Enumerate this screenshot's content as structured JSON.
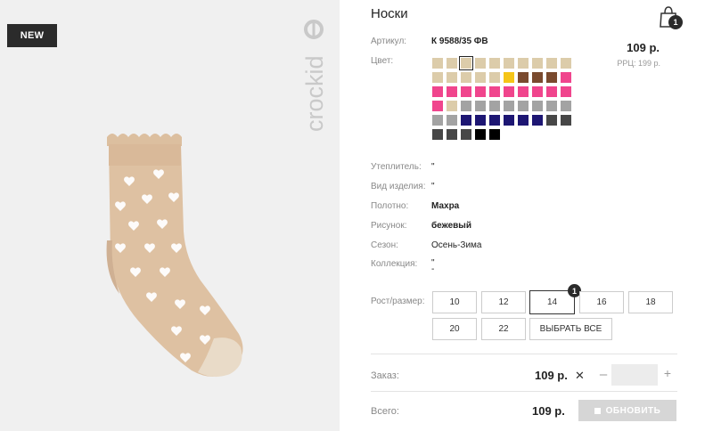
{
  "product": {
    "badge": "NEW",
    "brand": "crockid",
    "title": "Носки",
    "price": "109 р.",
    "rrp": "РРЦ: 199 р."
  },
  "cart": {
    "count": "1"
  },
  "colors": {
    "beige": "#dcccaa",
    "yellow": "#f5c518",
    "brown": "#7a4a2e",
    "pink": "#f0458d",
    "gray": "#a3a3a3",
    "navy": "#1d1673",
    "dark": "#474747",
    "black": "#000000",
    "button_disabled": "#d6d6d6"
  },
  "swatches": [
    "beige",
    "beige",
    "beige",
    "beige",
    "beige",
    "beige",
    "beige",
    "beige",
    "beige",
    "beige",
    "beige",
    "beige",
    "beige",
    "beige",
    "beige",
    "yellow",
    "brown",
    "brown",
    "brown",
    "pink",
    "pink",
    "pink",
    "pink",
    "pink",
    "pink",
    "pink",
    "pink",
    "pink",
    "pink",
    "pink",
    "pink",
    "beige",
    "gray",
    "gray",
    "gray",
    "gray",
    "gray",
    "gray",
    "gray",
    "gray",
    "gray",
    "gray",
    "navy",
    "navy",
    "navy",
    "navy",
    "navy",
    "navy",
    "dark",
    "dark",
    "dark",
    "dark",
    "dark",
    "black",
    "black"
  ],
  "selected_swatch": 2,
  "attributes": {
    "article_label": "Артикул:",
    "article_value": "К 9588/35 ФВ",
    "color_label": "Цвет:",
    "insulation_label": "Утеплитель:",
    "insulation_value": "\"",
    "type_label": "Вид изделия:",
    "type_value": "\"",
    "fabric_label": "Полотно:",
    "fabric_value": "Махра",
    "pattern_label": "Рисунок:",
    "pattern_value": "бежевый",
    "season_label": "Сезон:",
    "season_value": "Осень-Зима",
    "collection_label": "Коллекция:",
    "collection_value_1": "\"",
    "collection_value_2": "-"
  },
  "sizes": {
    "label": "Рост/размер:",
    "options": [
      "10",
      "12",
      "14",
      "16",
      "18",
      "20",
      "22"
    ],
    "select_all": "ВЫБРАТЬ ВСЕ",
    "selected_count": "1"
  },
  "order": {
    "label": "Заказ:",
    "price": "109 р.",
    "quantity": ""
  },
  "total": {
    "label": "Всего:",
    "price": "109 р.",
    "update_label": "ОБНОВИТЬ"
  },
  "icons": [
    "bag-icon",
    "close-icon",
    "minus-icon",
    "plus-icon",
    "refresh-icon"
  ]
}
